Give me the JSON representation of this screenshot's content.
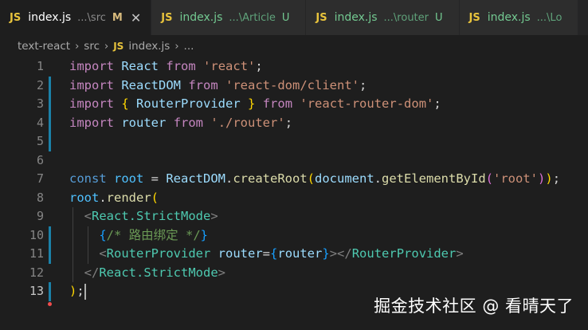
{
  "tabs": [
    {
      "lang": "JS",
      "name": "index.js",
      "path": "...\\src",
      "status": "M",
      "active": true,
      "close": "✕"
    },
    {
      "lang": "JS",
      "name": "index.js",
      "path": "...\\Article",
      "status": "U",
      "active": false
    },
    {
      "lang": "JS",
      "name": "index.js",
      "path": "...\\router",
      "status": "U",
      "active": false
    },
    {
      "lang": "JS",
      "name": "index.js",
      "path": "...\\Lo",
      "status": "",
      "active": false
    }
  ],
  "breadcrumb": {
    "project": "text-react",
    "folder": "src",
    "lang": "JS",
    "file": "index.js",
    "more": "..."
  },
  "editor": {
    "lines": [
      {
        "n": "1",
        "tokens": [
          [
            "import",
            "kw"
          ],
          [
            " ",
            "p"
          ],
          [
            "React",
            "var"
          ],
          [
            " ",
            "p"
          ],
          [
            "from",
            "kw"
          ],
          [
            " ",
            "p"
          ],
          [
            "'react'",
            "str"
          ],
          [
            ";",
            "p"
          ]
        ]
      },
      {
        "n": "2",
        "tokens": [
          [
            "import",
            "kw"
          ],
          [
            " ",
            "p"
          ],
          [
            "ReactDOM",
            "var"
          ],
          [
            " ",
            "p"
          ],
          [
            "from",
            "kw"
          ],
          [
            " ",
            "p"
          ],
          [
            "'react-dom/client'",
            "str"
          ],
          [
            ";",
            "p"
          ]
        ]
      },
      {
        "n": "3",
        "tokens": [
          [
            "import",
            "kw"
          ],
          [
            " ",
            "p"
          ],
          [
            "{",
            "b1"
          ],
          [
            " ",
            "p"
          ],
          [
            "RouterProvider",
            "var"
          ],
          [
            " ",
            "p"
          ],
          [
            "}",
            "b1"
          ],
          [
            " ",
            "p"
          ],
          [
            "from",
            "kw"
          ],
          [
            " ",
            "p"
          ],
          [
            "'react-router-dom'",
            "str"
          ],
          [
            ";",
            "p"
          ]
        ]
      },
      {
        "n": "4",
        "tokens": [
          [
            "import",
            "kw"
          ],
          [
            " ",
            "p"
          ],
          [
            "router",
            "var"
          ],
          [
            " ",
            "p"
          ],
          [
            "from",
            "kw"
          ],
          [
            " ",
            "p"
          ],
          [
            "'./router'",
            "str"
          ],
          [
            ";",
            "p"
          ]
        ]
      },
      {
        "n": "5",
        "tokens": []
      },
      {
        "n": "6",
        "tokens": []
      },
      {
        "n": "7",
        "tokens": [
          [
            "const",
            "decl"
          ],
          [
            " ",
            "p"
          ],
          [
            "root",
            "const"
          ],
          [
            " = ",
            "p"
          ],
          [
            "ReactDOM",
            "var"
          ],
          [
            ".",
            "p"
          ],
          [
            "createRoot",
            "fn"
          ],
          [
            "(",
            "b1"
          ],
          [
            "document",
            "var"
          ],
          [
            ".",
            "p"
          ],
          [
            "getElementById",
            "fn"
          ],
          [
            "(",
            "b2"
          ],
          [
            "'root'",
            "str"
          ],
          [
            ")",
            "b2"
          ],
          [
            ")",
            "b1"
          ],
          [
            ";",
            "p"
          ]
        ]
      },
      {
        "n": "8",
        "tokens": [
          [
            "root",
            "const"
          ],
          [
            ".",
            "p"
          ],
          [
            "render",
            "fn"
          ],
          [
            "(",
            "b1"
          ]
        ]
      },
      {
        "n": "9",
        "tokens": [
          [
            "  ",
            "p"
          ],
          [
            "<",
            "tagb"
          ],
          [
            "React.StrictMode",
            "comp"
          ],
          [
            ">",
            "tagb"
          ]
        ]
      },
      {
        "n": "10",
        "tokens": [
          [
            "    ",
            "p"
          ],
          [
            "{",
            "b3"
          ],
          [
            "/* 路由绑定 */",
            "cmt"
          ],
          [
            "}",
            "b3"
          ]
        ]
      },
      {
        "n": "11",
        "tokens": [
          [
            "    ",
            "p"
          ],
          [
            "<",
            "tagb"
          ],
          [
            "RouterProvider",
            "comp"
          ],
          [
            " ",
            "p"
          ],
          [
            "router",
            "attr"
          ],
          [
            "=",
            "p"
          ],
          [
            "{",
            "b3"
          ],
          [
            "router",
            "var"
          ],
          [
            "}",
            "b3"
          ],
          [
            "></",
            "tagb"
          ],
          [
            "RouterProvider",
            "comp"
          ],
          [
            ">",
            "tagb"
          ]
        ]
      },
      {
        "n": "12",
        "tokens": [
          [
            "  ",
            "p"
          ],
          [
            "</",
            "tagb"
          ],
          [
            "React.StrictMode",
            "comp"
          ],
          [
            ">",
            "tagb"
          ]
        ]
      },
      {
        "n": "13",
        "tokens": [
          [
            ")",
            "b1"
          ],
          [
            ";",
            "p"
          ]
        ]
      }
    ],
    "current_line": "13"
  },
  "colors": {
    "kw": "#c586c0",
    "var": "#9cdcfe",
    "str": "#ce9178",
    "p": "#d4d4d4",
    "b1": "#ffd700",
    "b2": "#da70d6",
    "b3": "#179fff",
    "decl": "#569cd6",
    "const": "#4fc1ff",
    "fn": "#dcdcaa",
    "comp": "#4ec9b0",
    "tagb": "#808080",
    "attr": "#9cdcfe",
    "cmt": "#6a9955"
  },
  "watermark": "掘金技术社区 @ 看晴天了"
}
